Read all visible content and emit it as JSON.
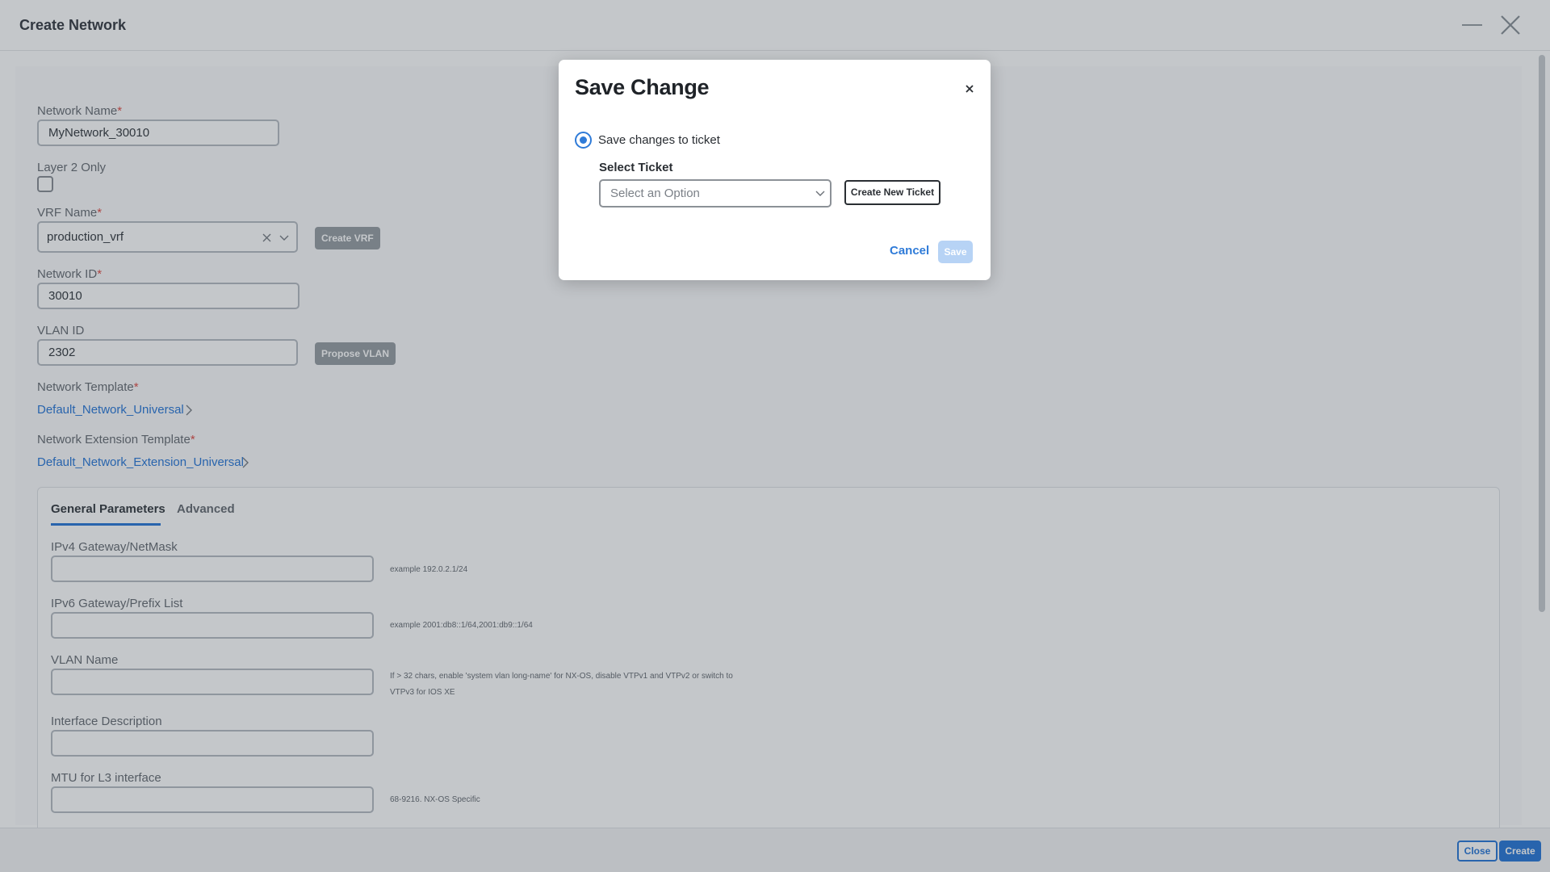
{
  "window": {
    "title": "Create Network"
  },
  "form": {
    "network_name": {
      "label": "Network Name",
      "value": "MyNetwork_30010"
    },
    "layer2_only": {
      "label": "Layer 2 Only",
      "checked": false
    },
    "vrf": {
      "label": "VRF Name",
      "value": "production_vrf",
      "create_button": "Create VRF"
    },
    "network_id": {
      "label": "Network ID",
      "value": "30010"
    },
    "vlan_id": {
      "label": "VLAN ID",
      "value": "2302",
      "propose_button": "Propose VLAN"
    },
    "network_template": {
      "label": "Network Template",
      "value": "Default_Network_Universal"
    },
    "extension_template": {
      "label": "Network Extension Template",
      "value": "Default_Network_Extension_Universal"
    },
    "required_mark": "*"
  },
  "tabs": [
    {
      "label": "General Parameters",
      "active": true
    },
    {
      "label": "Advanced",
      "active": false
    }
  ],
  "params": {
    "ipv4": {
      "label": "IPv4 Gateway/NetMask",
      "value": "",
      "hint": "example 192.0.2.1/24"
    },
    "ipv6": {
      "label": "IPv6 Gateway/Prefix List",
      "value": "",
      "hint": "example 2001:db8::1/64,2001:db9::1/64"
    },
    "vlan_name": {
      "label": "VLAN Name",
      "value": "",
      "hint_line1": "If > 32 chars, enable 'system vlan long-name' for NX-OS, disable VTPv1 and VTPv2 or switch to",
      "hint_line2": "VTPv3 for IOS XE"
    },
    "interface_description": {
      "label": "Interface Description",
      "value": ""
    },
    "mtu": {
      "label": "MTU for L3 interface",
      "value": "",
      "hint": "68-9216. NX-OS Specific"
    }
  },
  "footer": {
    "close_label": "Close",
    "create_label": "Create"
  },
  "modal": {
    "title": "Save Change",
    "radio_label": "Save changes to ticket",
    "radio_selected": true,
    "select_ticket_label": "Select Ticket",
    "select_placeholder": "Select an Option",
    "create_ticket_label": "Create New Ticket",
    "cancel_label": "Cancel",
    "save_label": "Save"
  },
  "colors": {
    "accent": "#2f7bd8",
    "required": "#e0524b",
    "save_disabled": "#b7d3f5"
  },
  "icons": [
    "minimize-icon",
    "close-icon",
    "clear-icon",
    "chevron-down-icon",
    "chevron-right-icon",
    "radio-selected-icon"
  ]
}
